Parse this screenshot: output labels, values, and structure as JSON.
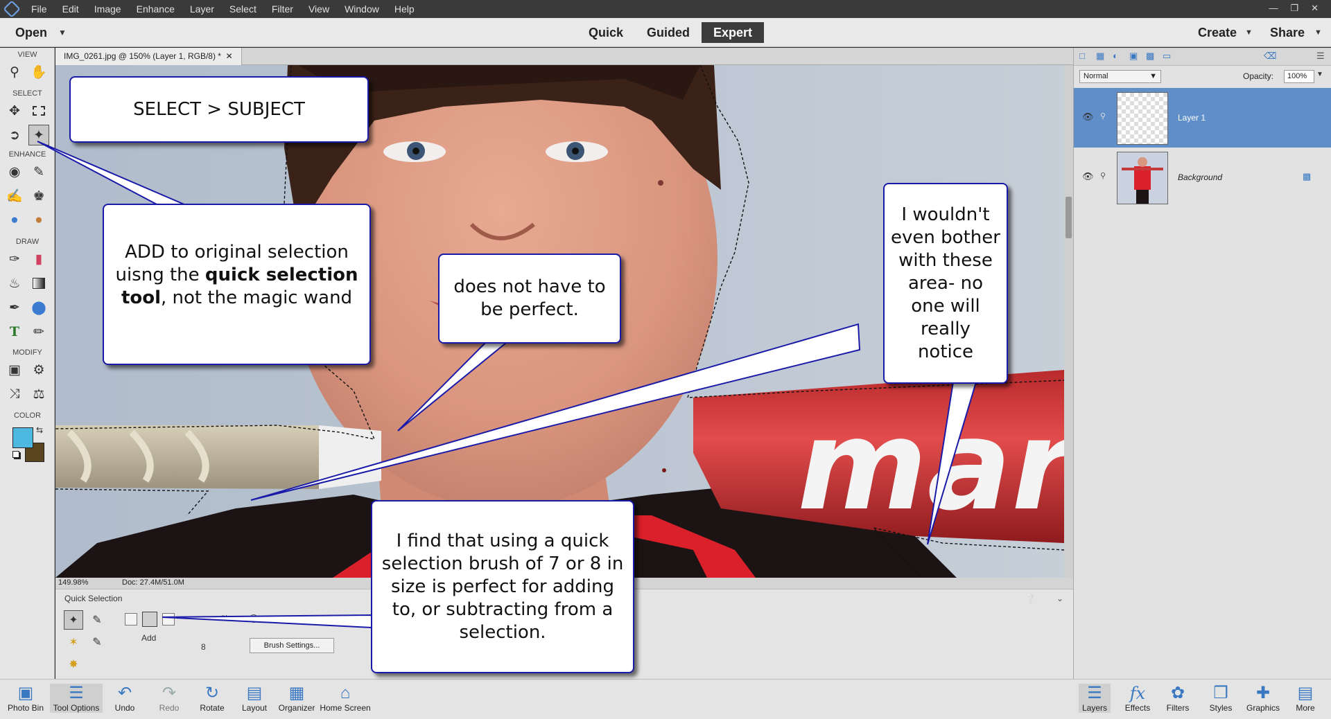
{
  "menubar": {
    "items": [
      "File",
      "Edit",
      "Image",
      "Enhance",
      "Layer",
      "Select",
      "Filter",
      "View",
      "Window",
      "Help"
    ]
  },
  "modebar": {
    "open_label": "Open",
    "modes": [
      "Quick",
      "Guided",
      "Expert"
    ],
    "active_mode": "Expert",
    "create_label": "Create",
    "share_label": "Share"
  },
  "toolbox": {
    "sections": [
      "VIEW",
      "SELECT",
      "ENHANCE",
      "DRAW",
      "MODIFY",
      "COLOR"
    ],
    "foreground_color": "#4db8e0",
    "background_color": "#5a4520"
  },
  "document": {
    "tab_title": "IMG_0261.jpg @ 150% (Layer 1, RGB/8) *",
    "zoom": "149.98%",
    "doc_size": "Doc: 27.4M/51.0M",
    "bat_text": "mar"
  },
  "options": {
    "tool_title": "Quick Selection",
    "mode_label": "Add",
    "size_label": "Size:",
    "size_value": "8 px",
    "brush_value": "8",
    "brush_settings_label": "Brush Settings..."
  },
  "layers": {
    "blend_mode": "Normal",
    "opacity_label": "Opacity:",
    "opacity_value": "100%",
    "items": [
      {
        "name": "Layer 1",
        "selected": true
      },
      {
        "name": "Background",
        "selected": false
      }
    ]
  },
  "bottombar": {
    "left": [
      "Photo Bin",
      "Tool Options",
      "Undo",
      "Redo",
      "Rotate",
      "Layout",
      "Organizer",
      "Home Screen"
    ],
    "right": [
      "Layers",
      "Effects",
      "Filters",
      "Styles",
      "Graphics",
      "More"
    ]
  },
  "callouts": {
    "select_subject": "SELECT > SUBJECT",
    "add_selection_pre": "ADD to original selection uisng the",
    "add_selection_bold": "quick selection tool",
    "add_selection_post": ", not the magic wand",
    "not_perfect": "does not have to be perfect.",
    "wouldnt_bother": "I wouldn't even bother with these area- no one will really notice",
    "brush_size": "I find that using a quick selection brush of 7 or 8 in size is perfect for adding to, or subtracting from a selection."
  }
}
